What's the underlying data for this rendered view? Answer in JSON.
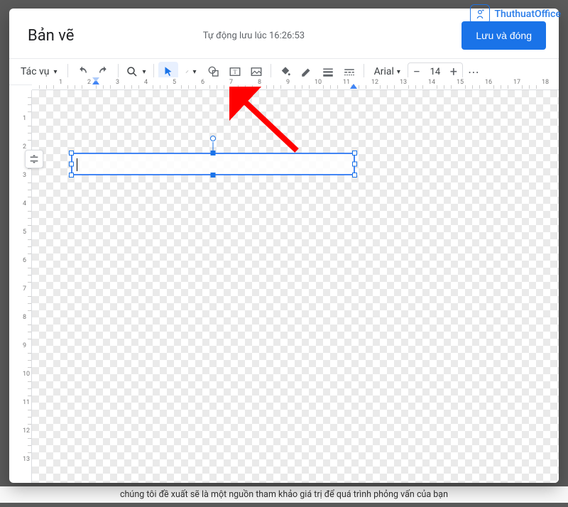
{
  "watermark": {
    "name": "ThuthuatOffice"
  },
  "header": {
    "title": "Bản vẽ",
    "autosave": "Tự động lưu lúc 16:26:53",
    "save_button": "Lưu và đóng"
  },
  "toolbar": {
    "actions_label": "Tác vụ",
    "font": "Arial",
    "font_size": "14",
    "minus": "−",
    "plus": "+"
  },
  "background_text": "chúng tôi đề xuất sẽ là một nguồn tham khảo giá trị để quá trình phỏng vấn của bạn",
  "ruler": {
    "h": [
      "1",
      "2",
      "3",
      "4",
      "5",
      "6",
      "7",
      "8",
      "9",
      "10",
      "11",
      "12",
      "13",
      "14",
      "15",
      "16",
      "17",
      "18"
    ],
    "v": [
      "1",
      "2",
      "3",
      "4",
      "5",
      "6",
      "7",
      "8",
      "9",
      "10",
      "11",
      "12",
      "13"
    ]
  }
}
